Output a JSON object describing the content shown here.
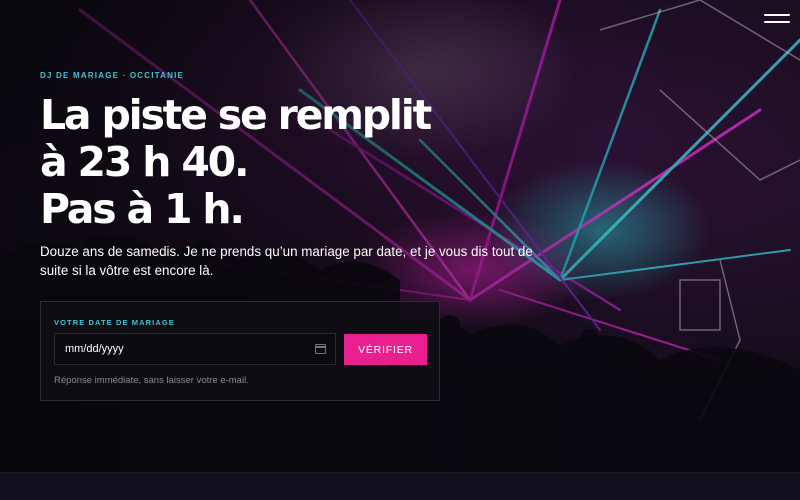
{
  "hero": {
    "eyebrow": "DJ DE MARIAGE · OCCITANIE",
    "headline_lines": [
      "La piste se remplit",
      "à 23 h 40.",
      "Pas à 1 h."
    ],
    "subtitle": "Douze ans de samedis. Je ne prends qu’un mariage par date, et je vous dis tout de suite si la vôtre est encore là."
  },
  "nav": {
    "menu_icon": "hamburger-menu-icon"
  },
  "form": {
    "label": "VOTRE DATE DE MARIAGE",
    "date_value": "mm/dd/yyyy",
    "calendar_icon": "calendar-icon",
    "submit_label": "VÉRIFIER",
    "note": "Réponse immédiate, sans laisser votre e-mail."
  },
  "colors": {
    "accent_pink": "#e8208f",
    "accent_cyan": "#3cc6d4",
    "background": "#0b0910"
  }
}
